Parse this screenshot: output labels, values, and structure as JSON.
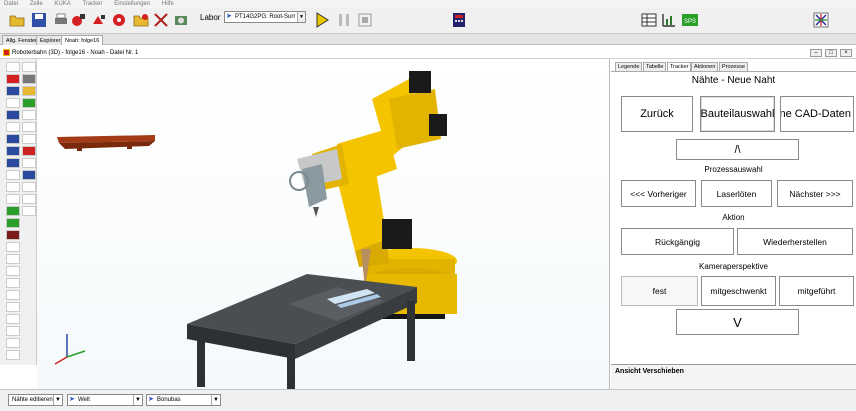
{
  "menu": [
    "Datei",
    "Zelle",
    "KUKA",
    "Tracker",
    "Einstellungen",
    "Hilfe"
  ],
  "toolbar": {
    "mode_label": "Labor",
    "mode_select_value": "PT14G2PG: Root-Surr"
  },
  "doc_tabs": [
    "Allg. Fenster",
    "Explorer",
    "Noah: folge16"
  ],
  "document": {
    "title": "Roboterbahn (3D) - folge16 - Noah - Datei Nr. 1"
  },
  "panel": {
    "tabs": [
      "Legende",
      "Tabelle",
      "Tracker",
      "Aktionen",
      "Prozesse"
    ],
    "heading": "Nähte - Neue Naht",
    "back_label": "Zurück",
    "part_select_label": "Bauteilauswahl",
    "no_cad_label": "ohne CAD-Daten",
    "up_label": "/\\",
    "process_heading": "Prozessauswahl",
    "prev_label": "<<< Vorheriger",
    "process_value": "Laserlöten",
    "next_label": "Nächster >>>",
    "action_heading": "Aktion",
    "undo_label": "Rückgängig",
    "redo_label": "Wiederherstellen",
    "camera_heading": "Kameraperspektive",
    "cam_fixed": "fest",
    "cam_swiveled": "mitgeschwenkt",
    "cam_guided": "mitgeführt",
    "down_label": "V",
    "footer_label": "Ansicht Verschieben"
  },
  "status": {
    "select1": "Nähte editieren",
    "select2": "Welt",
    "select3": "Bonubas"
  },
  "colors": {
    "robot": "#f5c400",
    "table": "#4a4e52",
    "beam": "#a33b16"
  }
}
